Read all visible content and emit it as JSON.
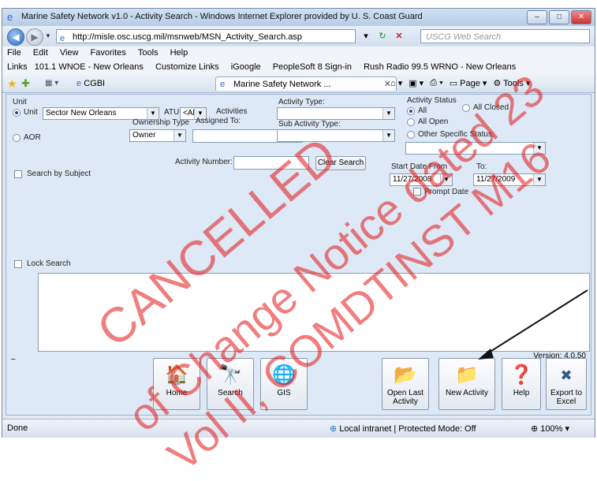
{
  "window": {
    "title": "Marine Safety Network v1.0 - Activity Search - Windows Internet Explorer provided by U. S. Coast Guard",
    "url": "http://misle.osc.uscg.mil/msnweb/MSN_Activity_Search.asp",
    "search_placeholder": "USCG Web Search"
  },
  "menubar": [
    "File",
    "Edit",
    "View",
    "Favorites",
    "Tools",
    "Help"
  ],
  "links": {
    "label": "Links",
    "items": [
      "101.1 WNOE - New Orleans",
      "Customize Links",
      "iGoogle",
      "PeopleSoft 8 Sign-in",
      "Rush Radio 99.5 WRNO - New Orleans"
    ]
  },
  "tabs": {
    "tab1": "CGBI",
    "tab2": "Marine Safety Network ...",
    "page_menu": "Page",
    "tools_menu": "Tools"
  },
  "form": {
    "unit_group_label": "Unit",
    "unit_radio_label": "Unit",
    "unit_value": "Sector New Orleans",
    "atu_label": "ATU",
    "atu_value": "<Al",
    "activities_assigned_label_1": "Activities",
    "activities_assigned_label_2": "Assigned To:",
    "ownership_type_label": "Ownership Type",
    "ownership_value": "Owner",
    "aor_label": "AOR",
    "activity_type_label": "Activity Type:",
    "sub_activity_type_label": "Sub Activity Type:",
    "activity_status_label": "Activity Status",
    "status_all": "All",
    "status_all_closed": "All Closed",
    "status_all_open": "All Open",
    "status_other": "Other Specific Status:",
    "activity_number_label": "Activity Number:",
    "clear_search_label": "Clear Search",
    "start_date_label": "Start Date From",
    "to_label": "To:",
    "start_date_value": "11/27/2008",
    "end_date_value": "11/27/2009",
    "prompt_date_label": "Prompt Date",
    "search_by_subject_label": "Search by Subject",
    "lock_search_label": "Lock Search"
  },
  "buttons": {
    "home": "Home",
    "search": "Search",
    "gis": "GIS",
    "open_last_1": "Open Last",
    "open_last_2": "Activity",
    "new_activity": "New Activity",
    "help": "Help",
    "export_1": "Export to",
    "export_2": "Excel"
  },
  "version": "Version: 4.0.50",
  "status": {
    "done": "Done",
    "zone": "Local intranet | Protected Mode: Off",
    "zoom": "100%"
  },
  "stamp": {
    "line1": "CANCELLED",
    "line2": "Change Notice dated 23",
    "line3": "COMDTINST M16",
    "prefix2": "of",
    "prefix3": "Vol II,",
    "color": "#e41616"
  }
}
